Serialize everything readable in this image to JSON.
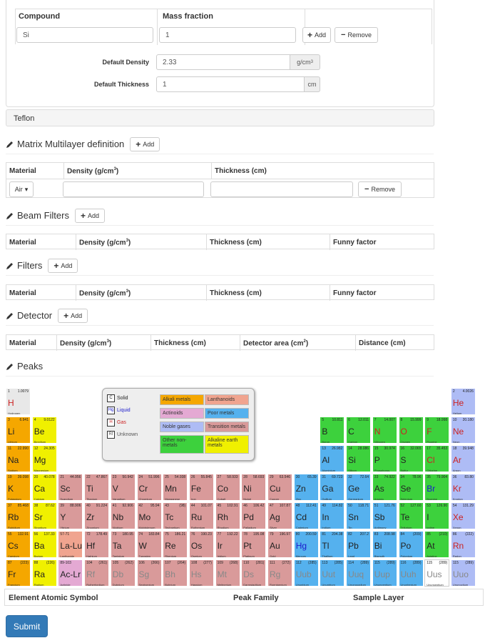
{
  "compound_panel": {
    "compound_header": "Compound",
    "mass_header": "Mass fraction",
    "compound_value": "Si",
    "mass_value": "1",
    "add_label": "Add",
    "remove_label": "Remove",
    "density_label": "Default Density",
    "density_value": "2.33",
    "density_unit": "g/cm",
    "density_unit_sup": "3",
    "thickness_label": "Default Thickness",
    "thickness_value": "1",
    "thickness_unit": "cm"
  },
  "teflon_label": "Teflon",
  "matrix": {
    "title": "Matrix Multilayer definition",
    "add_label": "Add",
    "headers": [
      "Material",
      "Density (g/cm",
      "Thickness (cm)"
    ],
    "sup": "3",
    "close": ")",
    "material_select": "Air",
    "remove_label": "Remove"
  },
  "beam_filters": {
    "title": "Beam Filters",
    "add_label": "Add",
    "headers": [
      "Material",
      "Density (g/cm",
      "Thickness (cm)",
      "Funny factor"
    ]
  },
  "filters": {
    "title": "Filters",
    "add_label": "Add",
    "headers": [
      "Material",
      "Density (g/cm",
      "Thickness (cm)",
      "Funny factor"
    ]
  },
  "detector": {
    "title": "Detector",
    "add_label": "Add",
    "headers": [
      "Material",
      "Density (g/cm",
      "Thickness (cm)",
      "Detector area (cm",
      "Distance (cm)"
    ],
    "area_sup": "2"
  },
  "peaks": {
    "title": "Peaks"
  },
  "legend": {
    "states": [
      {
        "sym": "C",
        "label": "Solid",
        "color": "#222222"
      },
      {
        "sym": "Hg",
        "label": "Liquid",
        "color": "#1a1acc"
      },
      {
        "sym": "H",
        "label": "Gas",
        "color": "#cc2222"
      },
      {
        "sym": "Rf",
        "label": "Unknown",
        "color": "#555555"
      }
    ],
    "categories": [
      {
        "label": "Alkali metals",
        "color": "#f5a700"
      },
      {
        "label": "Lanthanoids",
        "color": "#f0a48f"
      },
      {
        "label": "Actinoids",
        "color": "#e4a9d3"
      },
      {
        "label": "Poor metals",
        "color": "#55b1ee"
      },
      {
        "label": "Noble gases",
        "color": "#aebcf5"
      },
      {
        "label": "Transition metals",
        "color": "#d99a9a"
      },
      {
        "label": "Other non-metals",
        "color": "#3dd13d"
      },
      {
        "label": "Alkaline earth metals",
        "color": "#f0f000"
      }
    ]
  },
  "elements": [
    {
      "n": "1",
      "w": "1.0079",
      "s": "H",
      "f": "Hydrogen",
      "cat": "nonmetal-h",
      "st": "gas"
    },
    {
      "n": "2",
      "w": "4.0026",
      "s": "He",
      "f": "Helium",
      "cat": "noble",
      "st": "gas"
    },
    {
      "n": "3",
      "w": "6.941",
      "s": "Li",
      "f": "Lithium",
      "cat": "alkali",
      "st": "solid"
    },
    {
      "n": "4",
      "w": "9.0122",
      "s": "Be",
      "f": "Beryllium",
      "cat": "alkaline",
      "st": "solid"
    },
    {
      "n": "5",
      "w": "10.811",
      "s": "B",
      "f": "Boron",
      "cat": "other",
      "st": "solid"
    },
    {
      "n": "6",
      "w": "12.011",
      "s": "C",
      "f": "Carbon",
      "cat": "other",
      "st": "solid"
    },
    {
      "n": "7",
      "w": "14.007",
      "s": "N",
      "f": "Nitrogen",
      "cat": "other",
      "st": "gas"
    },
    {
      "n": "8",
      "w": "15.999",
      "s": "O",
      "f": "Oxygen",
      "cat": "other",
      "st": "gas"
    },
    {
      "n": "9",
      "w": "18.998",
      "s": "F",
      "f": "Fluorine",
      "cat": "other",
      "st": "gas"
    },
    {
      "n": "10",
      "w": "20.180",
      "s": "Ne",
      "f": "Neon",
      "cat": "noble",
      "st": "gas"
    },
    {
      "n": "11",
      "w": "22.990",
      "s": "Na",
      "f": "Sodium",
      "cat": "alkali",
      "st": "solid"
    },
    {
      "n": "12",
      "w": "24.305",
      "s": "Mg",
      "f": "Magnesium",
      "cat": "alkaline",
      "st": "solid"
    },
    {
      "n": "13",
      "w": "26.982",
      "s": "Al",
      "f": "Aluminium",
      "cat": "poor",
      "st": "solid"
    },
    {
      "n": "14",
      "w": "28.086",
      "s": "Si",
      "f": "Silicon",
      "cat": "other",
      "st": "solid"
    },
    {
      "n": "15",
      "w": "30.974",
      "s": "P",
      "f": "Phosphorus",
      "cat": "other",
      "st": "solid"
    },
    {
      "n": "16",
      "w": "32.065",
      "s": "S",
      "f": "Sulfur",
      "cat": "other",
      "st": "solid"
    },
    {
      "n": "17",
      "w": "35.453",
      "s": "Cl",
      "f": "Chlorine",
      "cat": "other",
      "st": "gas"
    },
    {
      "n": "18",
      "w": "39.948",
      "s": "Ar",
      "f": "Argon",
      "cat": "noble",
      "st": "gas"
    },
    {
      "n": "19",
      "w": "39.098",
      "s": "K",
      "f": "Potassium",
      "cat": "alkali",
      "st": "solid"
    },
    {
      "n": "20",
      "w": "40.078",
      "s": "Ca",
      "f": "Calcium",
      "cat": "alkaline",
      "st": "solid"
    },
    {
      "n": "21",
      "w": "44.956",
      "s": "Sc",
      "f": "Scandium",
      "cat": "transition",
      "st": "solid"
    },
    {
      "n": "22",
      "w": "47.867",
      "s": "Ti",
      "f": "Titanium",
      "cat": "transition",
      "st": "solid"
    },
    {
      "n": "23",
      "w": "50.942",
      "s": "V",
      "f": "Vanadium",
      "cat": "transition",
      "st": "solid"
    },
    {
      "n": "24",
      "w": "51.996",
      "s": "Cr",
      "f": "Chromium",
      "cat": "transition",
      "st": "solid"
    },
    {
      "n": "25",
      "w": "54.938",
      "s": "Mn",
      "f": "Manganese",
      "cat": "transition",
      "st": "solid"
    },
    {
      "n": "26",
      "w": "55.845",
      "s": "Fe",
      "f": "Iron",
      "cat": "transition",
      "st": "solid"
    },
    {
      "n": "27",
      "w": "58.933",
      "s": "Co",
      "f": "Cobalt",
      "cat": "transition",
      "st": "solid"
    },
    {
      "n": "28",
      "w": "58.693",
      "s": "Ni",
      "f": "Nickel",
      "cat": "transition",
      "st": "solid"
    },
    {
      "n": "29",
      "w": "63.546",
      "s": "Cu",
      "f": "Copper",
      "cat": "transition",
      "st": "solid"
    },
    {
      "n": "30",
      "w": "65.39",
      "s": "Zn",
      "f": "Zinc",
      "cat": "poor",
      "st": "solid"
    },
    {
      "n": "31",
      "w": "69.723",
      "s": "Ga",
      "f": "Gallium",
      "cat": "poor",
      "st": "solid"
    },
    {
      "n": "32",
      "w": "72.64",
      "s": "Ge",
      "f": "Germanium",
      "cat": "poor",
      "st": "solid"
    },
    {
      "n": "33",
      "w": "74.922",
      "s": "As",
      "f": "Arsenic",
      "cat": "other",
      "st": "solid"
    },
    {
      "n": "34",
      "w": "78.96",
      "s": "Se",
      "f": "Selenium",
      "cat": "other",
      "st": "solid"
    },
    {
      "n": "35",
      "w": "79.904",
      "s": "Br",
      "f": "Bromine",
      "cat": "other",
      "st": "liquid"
    },
    {
      "n": "36",
      "w": "83.80",
      "s": "Kr",
      "f": "Krypton",
      "cat": "noble",
      "st": "gas"
    },
    {
      "n": "37",
      "w": "85.468",
      "s": "Rb",
      "f": "Rubidium",
      "cat": "alkali",
      "st": "solid"
    },
    {
      "n": "38",
      "w": "87.62",
      "s": "Sr",
      "f": "Strontium",
      "cat": "alkaline",
      "st": "solid"
    },
    {
      "n": "39",
      "w": "88.906",
      "s": "Y",
      "f": "Yttrium",
      "cat": "transition",
      "st": "solid"
    },
    {
      "n": "40",
      "w": "91.224",
      "s": "Zr",
      "f": "Zirconium",
      "cat": "transition",
      "st": "solid"
    },
    {
      "n": "41",
      "w": "92.906",
      "s": "Nb",
      "f": "Niobium",
      "cat": "transition",
      "st": "solid"
    },
    {
      "n": "42",
      "w": "95.94",
      "s": "Mo",
      "f": "Molybdenum",
      "cat": "transition",
      "st": "solid"
    },
    {
      "n": "43",
      "w": "(98)",
      "s": "Tc",
      "f": "Technetium",
      "cat": "transition",
      "st": "solid"
    },
    {
      "n": "44",
      "w": "101.07",
      "s": "Ru",
      "f": "Ruthenium",
      "cat": "transition",
      "st": "solid"
    },
    {
      "n": "45",
      "w": "102.91",
      "s": "Rh",
      "f": "Rhodium",
      "cat": "transition",
      "st": "solid"
    },
    {
      "n": "46",
      "w": "106.42",
      "s": "Pd",
      "f": "Palladium",
      "cat": "transition",
      "st": "solid"
    },
    {
      "n": "47",
      "w": "107.87",
      "s": "Ag",
      "f": "Silver",
      "cat": "transition",
      "st": "solid"
    },
    {
      "n": "48",
      "w": "112.41",
      "s": "Cd",
      "f": "Cadmium",
      "cat": "poor",
      "st": "solid"
    },
    {
      "n": "49",
      "w": "114.82",
      "s": "In",
      "f": "Indium",
      "cat": "poor",
      "st": "solid"
    },
    {
      "n": "50",
      "w": "118.71",
      "s": "Sn",
      "f": "Tin",
      "cat": "poor",
      "st": "solid"
    },
    {
      "n": "51",
      "w": "121.76",
      "s": "Sb",
      "f": "Antimony",
      "cat": "poor",
      "st": "solid"
    },
    {
      "n": "52",
      "w": "127.60",
      "s": "Te",
      "f": "Tellurium",
      "cat": "other",
      "st": "solid"
    },
    {
      "n": "53",
      "w": "126.90",
      "s": "I",
      "f": "Iodine",
      "cat": "other",
      "st": "solid"
    },
    {
      "n": "54",
      "w": "131.29",
      "s": "Xe",
      "f": "Xenon",
      "cat": "noble",
      "st": "gas"
    },
    {
      "n": "55",
      "w": "132.91",
      "s": "Cs",
      "f": "Caesium",
      "cat": "alkali",
      "st": "solid"
    },
    {
      "n": "56",
      "w": "137.33",
      "s": "Ba",
      "f": "Barium",
      "cat": "alkaline",
      "st": "solid"
    },
    {
      "n": "57-71",
      "w": "",
      "s": "La-Lu",
      "f": "Lanthanide",
      "cat": "lanthanoid",
      "st": "solid"
    },
    {
      "n": "72",
      "w": "178.49",
      "s": "Hf",
      "f": "Hafnium",
      "cat": "transition",
      "st": "solid"
    },
    {
      "n": "73",
      "w": "180.95",
      "s": "Ta",
      "f": "Tantalum",
      "cat": "transition",
      "st": "solid"
    },
    {
      "n": "74",
      "w": "183.84",
      "s": "W",
      "f": "Tungsten",
      "cat": "transition",
      "st": "solid"
    },
    {
      "n": "75",
      "w": "186.21",
      "s": "Re",
      "f": "Rhenium",
      "cat": "transition",
      "st": "solid"
    },
    {
      "n": "76",
      "w": "190.23",
      "s": "Os",
      "f": "Osmium",
      "cat": "transition",
      "st": "solid"
    },
    {
      "n": "77",
      "w": "192.22",
      "s": "Ir",
      "f": "Iridium",
      "cat": "transition",
      "st": "solid"
    },
    {
      "n": "78",
      "w": "195.08",
      "s": "Pt",
      "f": "Platinum",
      "cat": "transition",
      "st": "solid"
    },
    {
      "n": "79",
      "w": "196.97",
      "s": "Au",
      "f": "Gold",
      "cat": "transition",
      "st": "solid"
    },
    {
      "n": "80",
      "w": "200.59",
      "s": "Hg",
      "f": "Mercury",
      "cat": "poor",
      "st": "liquid"
    },
    {
      "n": "81",
      "w": "204.38",
      "s": "Tl",
      "f": "Thallium",
      "cat": "poor",
      "st": "solid"
    },
    {
      "n": "82",
      "w": "207.2",
      "s": "Pb",
      "f": "Lead",
      "cat": "poor",
      "st": "solid"
    },
    {
      "n": "83",
      "w": "208.98",
      "s": "Bi",
      "f": "Bismuth",
      "cat": "poor",
      "st": "solid"
    },
    {
      "n": "84",
      "w": "(209)",
      "s": "Po",
      "f": "Polonium",
      "cat": "poor",
      "st": "solid"
    },
    {
      "n": "85",
      "w": "(210)",
      "s": "At",
      "f": "Astatine",
      "cat": "other",
      "st": "solid"
    },
    {
      "n": "86",
      "w": "(222)",
      "s": "Rn",
      "f": "Radon",
      "cat": "noble",
      "st": "gas"
    },
    {
      "n": "87",
      "w": "(223)",
      "s": "Fr",
      "f": "Francium",
      "cat": "alkali",
      "st": "solid"
    },
    {
      "n": "88",
      "w": "(226)",
      "s": "Ra",
      "f": "Radium",
      "cat": "alkaline",
      "st": "solid"
    },
    {
      "n": "89-103",
      "w": "",
      "s": "Ac-Lr",
      "f": "Actinide",
      "cat": "actinoid",
      "st": "solid"
    },
    {
      "n": "104",
      "w": "(261)",
      "s": "Rf",
      "f": "Rutherfordium",
      "cat": "transition",
      "st": "unknown"
    },
    {
      "n": "105",
      "w": "(262)",
      "s": "Db",
      "f": "Dubnium",
      "cat": "transition",
      "st": "unknown"
    },
    {
      "n": "106",
      "w": "(266)",
      "s": "Sg",
      "f": "Seaborgium",
      "cat": "transition",
      "st": "unknown"
    },
    {
      "n": "107",
      "w": "(264)",
      "s": "Bh",
      "f": "Bohrium",
      "cat": "transition",
      "st": "unknown"
    },
    {
      "n": "108",
      "w": "(277)",
      "s": "Hs",
      "f": "Hassium",
      "cat": "transition",
      "st": "unknown"
    },
    {
      "n": "109",
      "w": "(268)",
      "s": "Mt",
      "f": "Meitnerium",
      "cat": "transition",
      "st": "unknown"
    },
    {
      "n": "110",
      "w": "(281)",
      "s": "Ds",
      "f": "Darmstadtium",
      "cat": "transition",
      "st": "unknown"
    },
    {
      "n": "111",
      "w": "(272)",
      "s": "Rg",
      "f": "Roentgenium",
      "cat": "transition",
      "st": "unknown"
    },
    {
      "n": "112",
      "w": "(285)",
      "s": "Uub",
      "f": "Ununbium",
      "cat": "poor",
      "st": "unknown"
    },
    {
      "n": "113",
      "w": "(285)",
      "s": "Uut",
      "f": "Ununtrium",
      "cat": "poor",
      "st": "unknown"
    },
    {
      "n": "114",
      "w": "(289)",
      "s": "Uuq",
      "f": "Ununquadium",
      "cat": "poor",
      "st": "unknown"
    },
    {
      "n": "115",
      "w": "(289)",
      "s": "Uup",
      "f": "Ununpentium",
      "cat": "poor",
      "st": "unknown"
    },
    {
      "n": "116",
      "w": "(289)",
      "s": "Uuh",
      "f": "Ununhexium",
      "cat": "poor",
      "st": "unknown"
    },
    {
      "n": "115",
      "w": "(289)",
      "s": "Uus",
      "f": "Ununseptium",
      "cat": "blank",
      "st": "unknown"
    },
    {
      "n": "115",
      "w": "(289)",
      "s": "Uuo",
      "f": "Ununoctium",
      "cat": "noble",
      "st": "unknown"
    }
  ],
  "category_colors": {
    "nonmetal-h": "#e8e8e8",
    "alkali": "#f5a700",
    "alkaline": "#f0f000",
    "transition": "#d99a9a",
    "poor": "#55b1ee",
    "other": "#3dd13d",
    "noble": "#aebcf5",
    "lanthanoid": "#f0a48f",
    "actinoid": "#e4a9d3",
    "blank": "#ffffff"
  },
  "state_colors": {
    "solid": "#222222",
    "liquid": "#1a1acc",
    "gas": "#cc2222",
    "unknown": "#888888"
  },
  "bottom_table": {
    "headers": [
      "Element Atomic Symbol",
      "Peak Family",
      "Sample Layer"
    ]
  },
  "submit_label": "Submit"
}
